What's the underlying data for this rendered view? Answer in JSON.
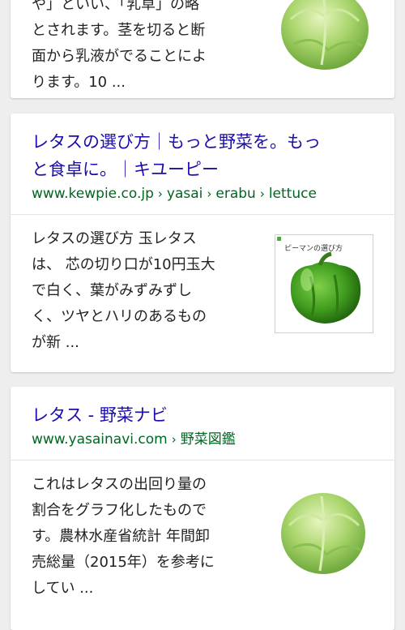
{
  "results": [
    {
      "snippet_lines": [
        "や」といい、「乳草」の略",
        "とされます。茎を切ると断",
        "面から乳液がでることによ",
        "ります。10 ..."
      ],
      "thumbnail": "lettuce-image"
    },
    {
      "title_lines": [
        "レタスの選び方｜もっと野菜を。もっ",
        "と食卓に。｜キユーピー"
      ],
      "url": {
        "domain": "www.kewpie.co.jp",
        "path": [
          "yasai",
          "erabu",
          "lettuce"
        ],
        "separator": "›"
      },
      "snippet_lines": [
        "レタスの選び方 玉レタス",
        "は、 芯の切り口が10円玉大",
        "で白く、葉がみずみずし",
        "く、ツヤとハリのあるもの",
        "が新 ..."
      ],
      "thumbnail": "green-pepper-image",
      "thumbnail_caption": "ピーマンの選び方"
    },
    {
      "title_lines": [
        "レタス - 野菜ナビ"
      ],
      "url": {
        "domain": "www.yasainavi.com",
        "path": [
          "野菜図鑑"
        ],
        "separator": "›"
      },
      "snippet_lines": [
        "これはレタスの出回り量の",
        "割合をグラフ化したもので",
        "す。農林水産省統計 年間卸",
        "売総量（2015年）を参考に",
        "してい ..."
      ],
      "thumbnail": "lettuce-image"
    }
  ],
  "colors": {
    "title": "#1a0dab",
    "url": "#006621",
    "snippet": "#222222",
    "background": "#eeeeee"
  }
}
